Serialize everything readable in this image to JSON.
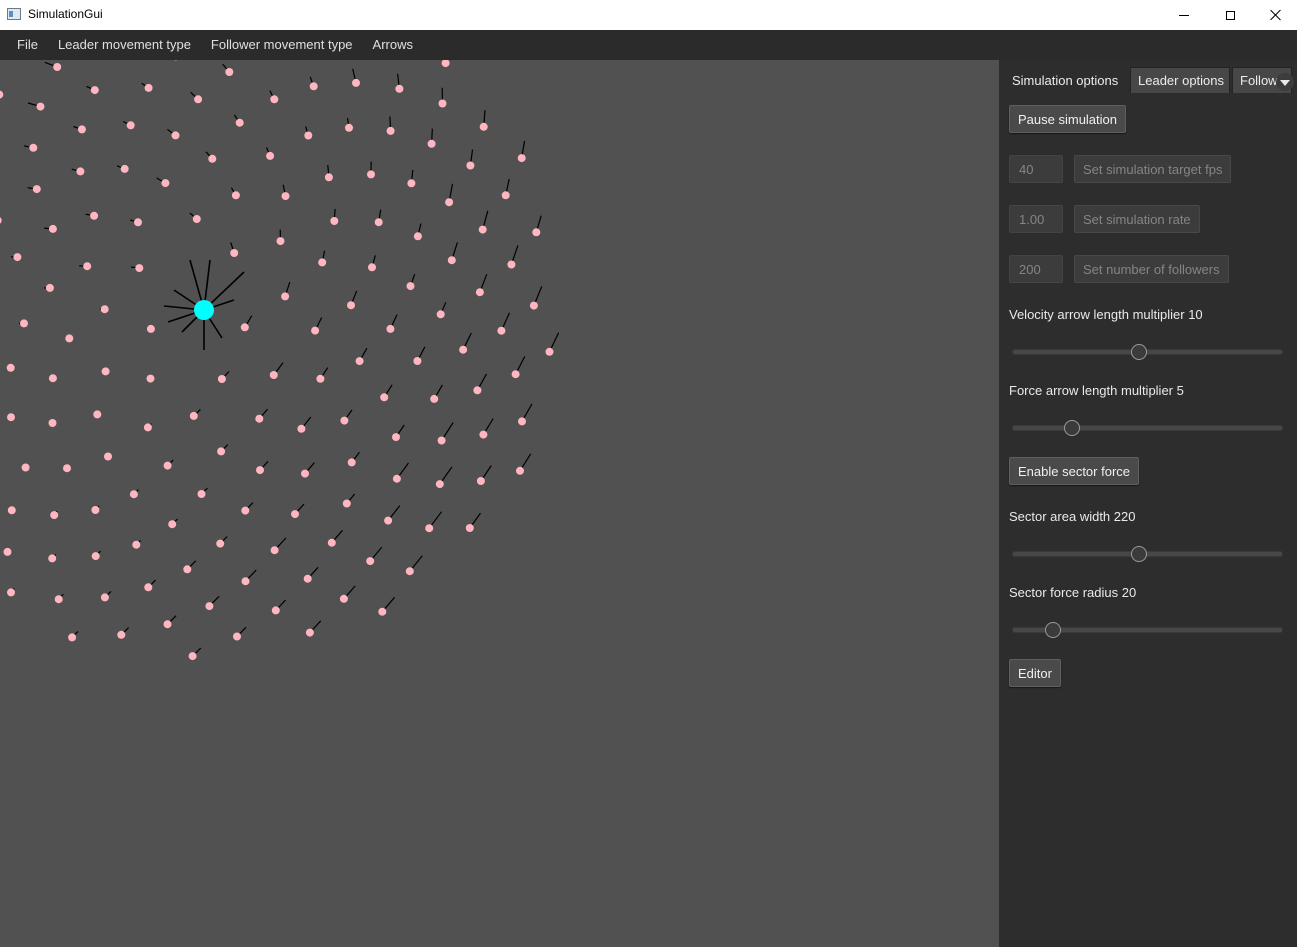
{
  "window": {
    "title": "SimulationGui",
    "minimize_icon": "minimize-icon",
    "maximize_icon": "maximize-icon",
    "close_icon": "close-icon"
  },
  "menu": {
    "items": [
      {
        "label": "File"
      },
      {
        "label": "Leader movement type"
      },
      {
        "label": "Follower movement type"
      },
      {
        "label": "Arrows"
      }
    ]
  },
  "colors": {
    "canvas_background": "#515151",
    "follower": "#ffb6c1",
    "leader": "#00ffff",
    "arrow": "#000000"
  },
  "panel": {
    "tabs": [
      {
        "label": "Simulation options",
        "active": true
      },
      {
        "label": "Leader options",
        "active": false
      },
      {
        "label": "Followers",
        "active": false
      }
    ],
    "pause_button": "Pause simulation",
    "fps": {
      "value": "40",
      "button": "Set simulation target fps"
    },
    "rate": {
      "value": "1.00",
      "button": "Set simulation rate"
    },
    "followers": {
      "value": "200",
      "button": "Set number of followers"
    },
    "velocity_slider": {
      "label": "Velocity arrow length multiplier 10",
      "fraction": 0.47
    },
    "force_slider": {
      "label": "Force arrow length multiplier 5",
      "fraction": 0.22
    },
    "sector_button": "Enable sector force",
    "sector_width_slider": {
      "label": "Sector area width 220",
      "fraction": 0.47
    },
    "sector_radius_slider": {
      "label": "Sector force radius 20",
      "fraction": 0.15
    },
    "editor_button": "Editor"
  }
}
